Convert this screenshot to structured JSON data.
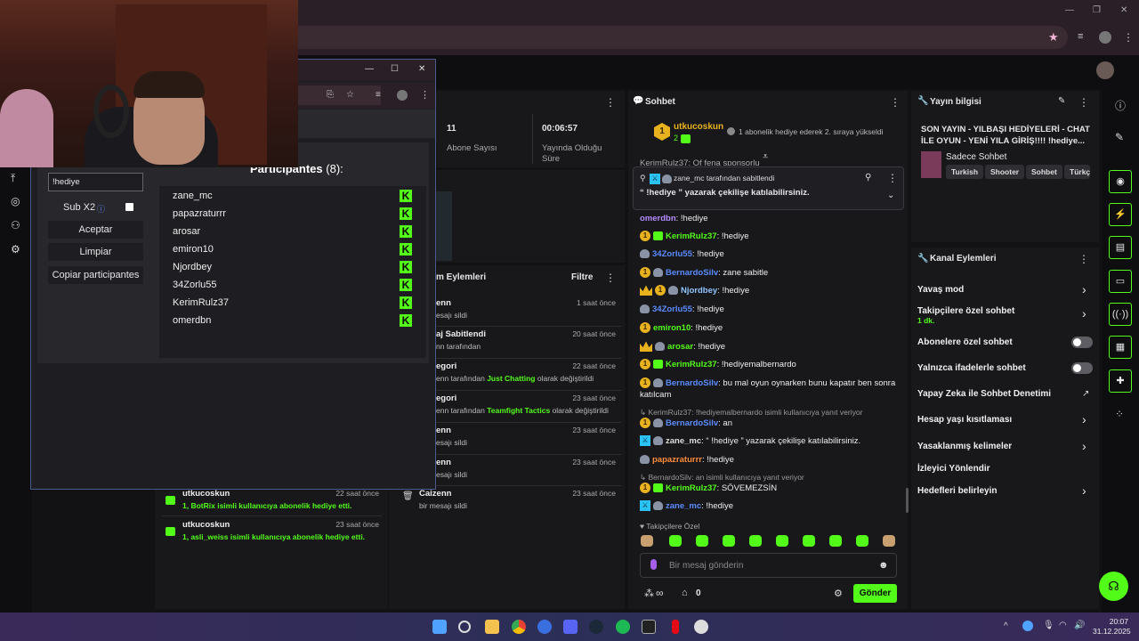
{
  "chat": {
    "title": "Sohbet",
    "top_user": "utkucoskun",
    "top_user_count": "2",
    "top_note": "1 abonelik hediye ederek 2. sıraya yükseldi",
    "cut_line": "KerimRulz37: Of fena sponsorlu",
    "pinned_by": "zane_mc tarafından sabitlendi",
    "pinned_text": "“ !hediye ” yazarak çekilişe katılabilirsiniz.",
    "messages": [
      {
        "user": "omerdbn",
        "color": "#b48cff",
        "text": ": !hediye",
        "badges": []
      },
      {
        "user": "KerimRulz37",
        "color": "#53fc18",
        "text": ": !hediye",
        "badges": [
          "sub",
          "green"
        ]
      },
      {
        "user": "34Zorlu55",
        "color": "#5b8cff",
        "text": ": !hediye",
        "badges": [
          "alien"
        ]
      },
      {
        "user": "BernardoSilv",
        "color": "#5b8cff",
        "text": ": zane sabitle",
        "badges": [
          "sub",
          "alien"
        ]
      },
      {
        "user": "Njordbey",
        "color": "#8ec5ff",
        "text": ": !hediye",
        "badges": [
          "crown",
          "sub",
          "alien"
        ]
      },
      {
        "user": "34Zorlu55",
        "color": "#5b8cff",
        "text": ": !hediye",
        "badges": [
          "alien"
        ]
      },
      {
        "user": "emiron10",
        "color": "#53fc18",
        "text": ": !hediye",
        "badges": [
          "sub"
        ]
      },
      {
        "user": "arosar",
        "color": "#53fc18",
        "text": ": !hediye",
        "badges": [
          "crown",
          "alien"
        ]
      },
      {
        "user": "KerimRulz37",
        "color": "#53fc18",
        "text": ": !hediyemalbernardo",
        "badges": [
          "sub",
          "green"
        ]
      },
      {
        "user": "BernardoSilv",
        "color": "#5b8cff",
        "text": ": bu mal oyun oynarken bunu kapatır ben sonra katılcam",
        "badges": [
          "sub",
          "alien"
        ]
      }
    ],
    "reply1": "KerimRulz37: !hediyemalbernardo isimli kullanıcıya yanıt veriyor",
    "reply1_msg": {
      "user": "BernardoSilv",
      "text": ": an"
    },
    "mod_msg": {
      "user": "zane_mc",
      "text": ": “ !hediye ” yazarak çekilişe katılabilirsiniz."
    },
    "papaz_msg": {
      "user": "papazraturrr",
      "text": ": !hediye"
    },
    "reply2": "BernardoSilv: an isimli kullanıcıya yanıt veriyor",
    "reply2_msg": {
      "user": "KerimRulz37",
      "text": ": SÖVEMEZSİN"
    },
    "zane_msg": {
      "user": "zane_mc",
      "text": ": !hediye"
    },
    "followers_only": "Takipçilere Özel",
    "input_placeholder": "Bir mesaj gönderin",
    "points": "∞",
    "store_count": "0",
    "send": "Gönder"
  },
  "stream_info": {
    "title": "Yayın bilgisi",
    "stream_title": "SON YAYIN - YILBAŞI HEDİYELERİ - CHAT İLE OYUN - YENİ YILA GİRİŞ!!!! !hediye...",
    "category": "Sadece Sohbet",
    "tags": [
      "Turkish",
      "Shooter",
      "Sohbet",
      "Türkç"
    ]
  },
  "channel_actions": {
    "title": "Kanal Eylemleri",
    "items": [
      {
        "label": "Yavaş mod",
        "kind": "chevron"
      },
      {
        "label": "Takipçilere özel sohbet",
        "sub": "1 dk.",
        "kind": "chevron"
      },
      {
        "label": "Abonelere özel sohbet",
        "kind": "toggle"
      },
      {
        "label": "Yalnızca ifadelerle sohbet",
        "kind": "toggle"
      },
      {
        "label": "Yapay Zeka ile Sohbet Denetimi",
        "kind": "external"
      },
      {
        "label": "Hesap yaşı kısıtlaması",
        "kind": "chevron"
      },
      {
        "label": "Yasaklanmış kelimeler",
        "kind": "chevron"
      },
      {
        "label": "İzleyici Yönlendir",
        "kind": "none"
      },
      {
        "label": "Hedefleri belirleyin",
        "kind": "chevron"
      }
    ]
  },
  "stats": {
    "subs_value": "11",
    "subs_label": "Abone Sayısı",
    "uptime_value": "00:06:57",
    "uptime_label": "Yayında Olduğu Süre"
  },
  "mod_actions": {
    "title_partial": "m Eylemleri",
    "filter": "Filtre",
    "rows": [
      {
        "title": "enn",
        "sub": "esajı sildi",
        "time": "1 saat önce"
      },
      {
        "title": "aj Sabitlendi",
        "sub": "nn tarafından",
        "time": "20 saat önce"
      },
      {
        "title": "egori",
        "sub": "enn tarafından ",
        "highlight": "Just Chatting",
        "sub2": " olarak değiştirildi",
        "time": "22 saat önce"
      },
      {
        "title": "egori",
        "sub": "enn tarafından ",
        "highlight": "Teamfight Tactics",
        "sub2": " olarak değiştirildi",
        "time": "23 saat önce"
      },
      {
        "title": "enn",
        "sub": "esajı sildi",
        "time": "23 saat önce"
      },
      {
        "title": "enn",
        "sub": "esajı sildi",
        "time": "23 saat önce"
      },
      {
        "title": "Caizenn",
        "sub": "bir mesajı sildi",
        "time": "23 saat önce"
      }
    ]
  },
  "activity": {
    "rows": [
      {
        "user": "utkucoskun",
        "time": "22 saat önce",
        "prefix": "1, ",
        "target": "BotRix",
        "text": " isimli kullanıcıya abonelik hediye etti."
      },
      {
        "user": "utkucoskun",
        "time": "23 saat önce",
        "prefix": "1, ",
        "target": "asli_weiss",
        "text": " isimli kullanıcıya abonelik hediye etti."
      }
    ]
  },
  "giveaway": {
    "search_value": "!hediye",
    "sub_label": "Sub X2",
    "accept": "Aceptar",
    "clear": "Limpiar",
    "copy": "Copiar participantes",
    "participants_title": "Participantes",
    "participants_count": "(8):",
    "participants": [
      "zane_mc",
      "papazraturrr",
      "arosar",
      "emiron10",
      "Njordbey",
      "34Zorlu55",
      "KerimRulz37",
      "omerdbn"
    ]
  },
  "taskbar": {
    "time": "20:07",
    "date": "31.12.2025"
  },
  "colors": {
    "accent": "#53fc18",
    "panel": "#18181b",
    "taskbar": "#2b2f57"
  }
}
